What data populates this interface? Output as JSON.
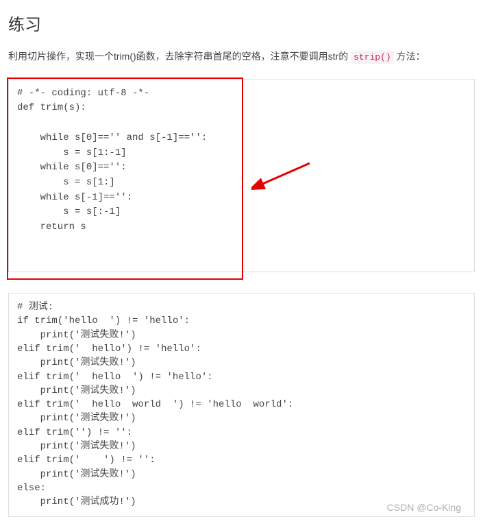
{
  "heading": "练习",
  "intro_before": "利用切片操作，实现一个trim()函数，去除字符串首尾的空格，注意不要调用str的 ",
  "intro_code": "strip()",
  "intro_after": " 方法：",
  "code1": "# -*- coding: utf-8 -*-\ndef trim(s):\n\n    while s[0]=='' and s[-1]=='':\n        s = s[1:-1]\n    while s[0]=='':\n        s = s[1:]\n    while s[-1]=='':\n        s = s[:-1]\n    return s\n\n\n",
  "code2": "# 测试:\nif trim('hello  ') != 'hello':\n    print('测试失败!')\nelif trim('  hello') != 'hello':\n    print('测试失败!')\nelif trim('  hello  ') != 'hello':\n    print('测试失败!')\nelif trim('  hello  world  ') != 'hello  world':\n    print('测试失败!')\nelif trim('') != '':\n    print('测试失败!')\nelif trim('    ') != '':\n    print('测试失败!')\nelse:\n    print('测试成功!')",
  "watermark": "CSDN @Co-King"
}
